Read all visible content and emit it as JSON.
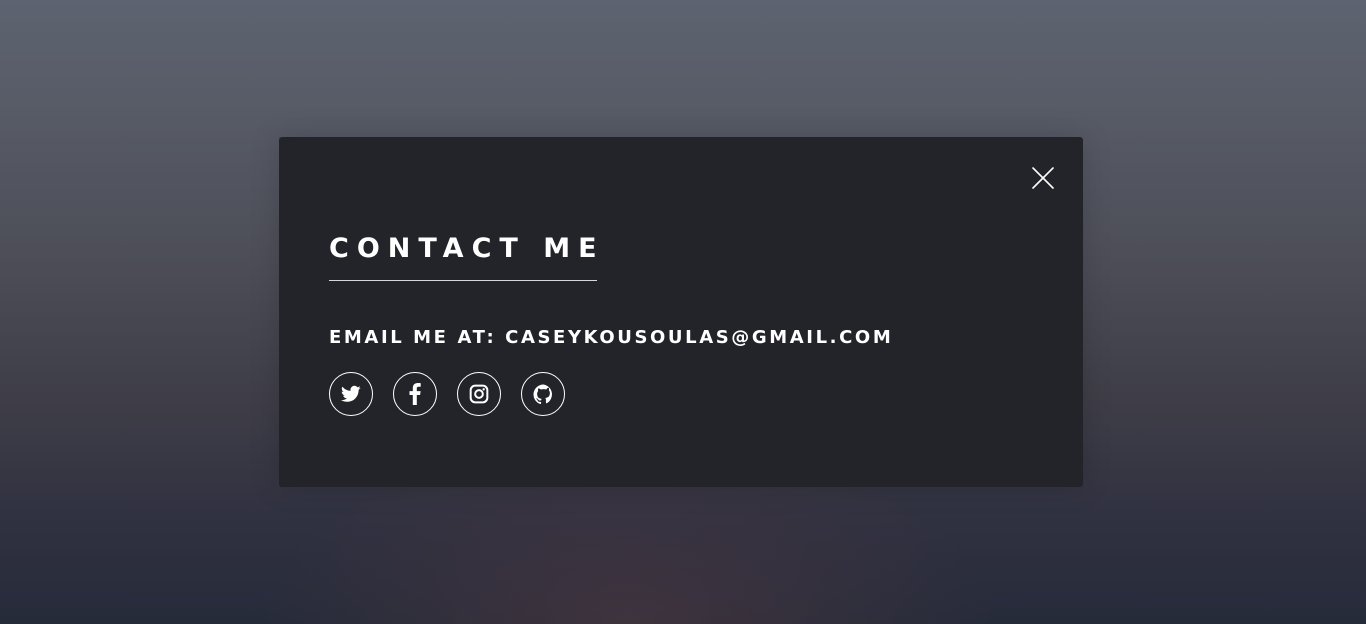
{
  "modal": {
    "title": "CONTACT ME",
    "email_label": "EMAIL ME AT:",
    "email_address": "CASEYKOUSOULAS@GMAIL.COM",
    "close_icon": "close-icon"
  },
  "social_links": [
    {
      "icon": "twitter-icon"
    },
    {
      "icon": "facebook-icon"
    },
    {
      "icon": "instagram-icon"
    },
    {
      "icon": "github-icon"
    }
  ],
  "colors": {
    "modal_background": "#23242a",
    "text": "#ffffff",
    "underline": "#d8d8da"
  }
}
